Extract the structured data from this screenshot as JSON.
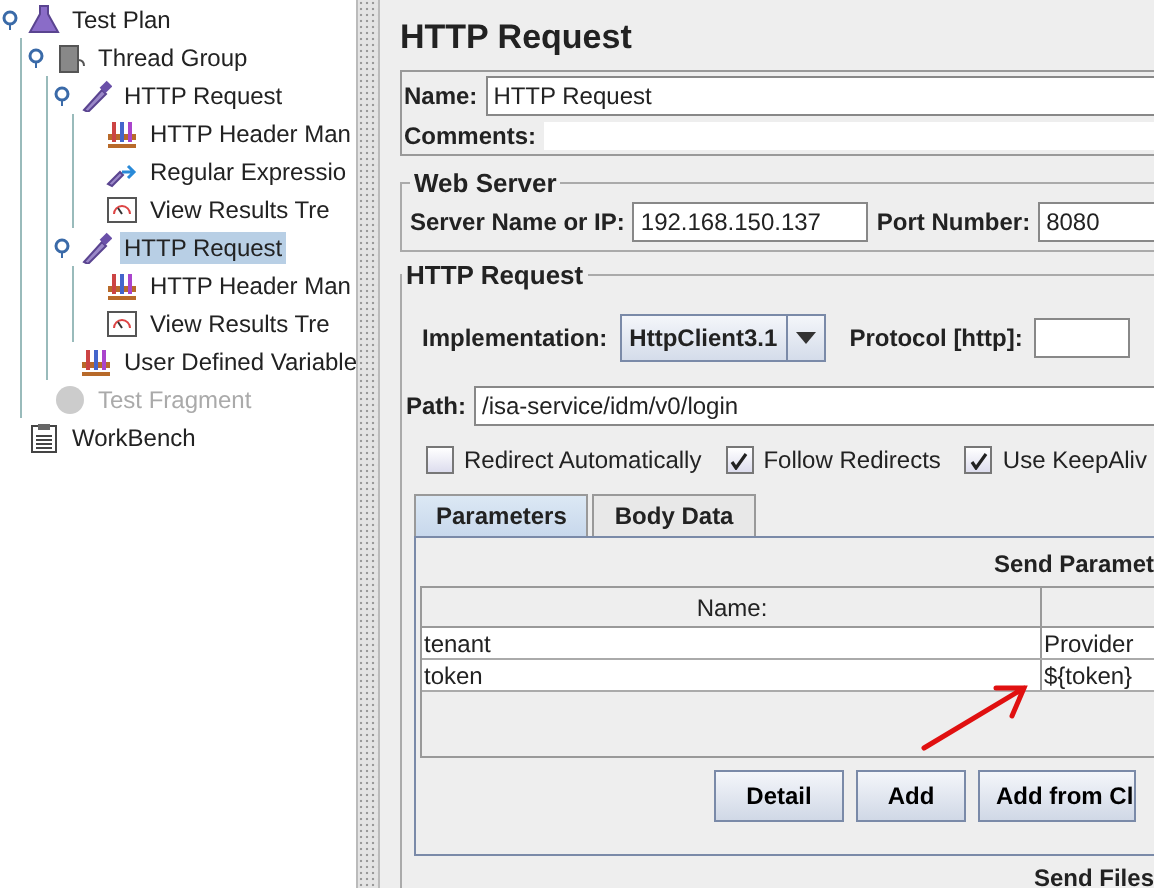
{
  "tree": [
    {
      "label": "Test Plan",
      "kind": "testplan",
      "selected": false,
      "disabled": false,
      "children": [
        {
          "label": "Thread Group",
          "kind": "threadgroup",
          "selected": false,
          "disabled": false,
          "children": [
            {
              "label": "HTTP Request",
              "kind": "sampler",
              "selected": false,
              "disabled": false,
              "children": [
                {
                  "label": "HTTP Header Man",
                  "kind": "config",
                  "selected": false,
                  "disabled": false
                },
                {
                  "label": "Regular Expressio",
                  "kind": "extractor",
                  "selected": false,
                  "disabled": false
                },
                {
                  "label": "View Results Tre",
                  "kind": "listener",
                  "selected": false,
                  "disabled": false
                }
              ]
            },
            {
              "label": "HTTP Request",
              "kind": "sampler",
              "selected": true,
              "disabled": false,
              "children": [
                {
                  "label": "HTTP Header Man",
                  "kind": "config",
                  "selected": false,
                  "disabled": false
                },
                {
                  "label": "View Results Tre",
                  "kind": "listener",
                  "selected": false,
                  "disabled": false
                }
              ]
            },
            {
              "label": "User Defined Variable",
              "kind": "config",
              "selected": false,
              "disabled": false
            }
          ]
        },
        {
          "label": "Test Fragment",
          "kind": "fragment",
          "selected": false,
          "disabled": true
        }
      ]
    },
    {
      "label": "WorkBench",
      "kind": "workbench",
      "selected": false,
      "disabled": false
    }
  ],
  "editor": {
    "title": "HTTP Request",
    "name": {
      "label": "Name:",
      "value": "HTTP Request"
    },
    "comments": {
      "label": "Comments:"
    },
    "web_server": {
      "legend": "Web Server",
      "server": {
        "label": "Server Name or IP:",
        "value": "192.168.150.137"
      },
      "port": {
        "label": "Port Number:",
        "value": "8080"
      }
    },
    "http_request": {
      "legend": "HTTP Request",
      "implementation": {
        "label": "Implementation:",
        "value": "HttpClient3.1"
      },
      "protocol": {
        "label": "Protocol [http]:"
      },
      "path": {
        "label": "Path:",
        "value": "/isa-service/idm/v0/login"
      },
      "options": [
        {
          "label": "Redirect Automatically",
          "checked": false
        },
        {
          "label": "Follow Redirects",
          "checked": true
        },
        {
          "label": "Use KeepAliv",
          "checked": true
        }
      ],
      "tabs": [
        {
          "label": "Parameters",
          "selected": true
        },
        {
          "label": "Body Data",
          "selected": false
        }
      ],
      "parameters": {
        "title": "Send Paramet",
        "columns": [
          "Name:"
        ],
        "rows": [
          {
            "name": "tenant",
            "value": "Provider"
          },
          {
            "name": "token",
            "value": "${token}"
          }
        ]
      },
      "buttons": [
        "Detail",
        "Add",
        "Add from Cl"
      ]
    },
    "files_title": "Send Files"
  }
}
